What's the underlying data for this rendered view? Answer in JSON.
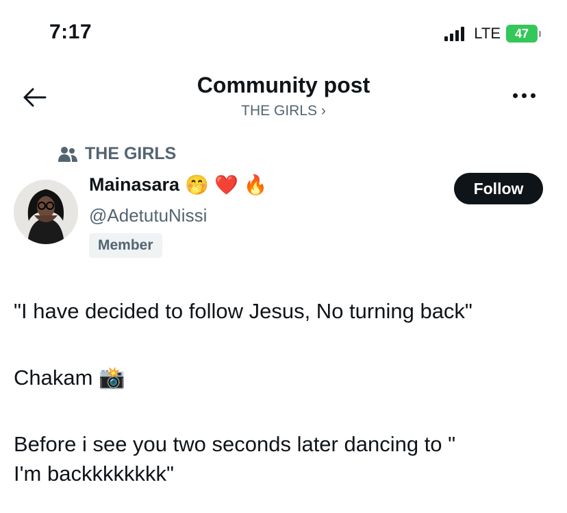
{
  "status_bar": {
    "time": "7:17",
    "network": "LTE",
    "battery": "47",
    "battery_color": "#34c759"
  },
  "header": {
    "title": "Community post",
    "subtitle": "THE GIRLS ›",
    "back_icon": "arrow-left-icon",
    "more_icon": "more-horizontal-icon"
  },
  "community": {
    "icon": "people-icon",
    "name": "THE GIRLS"
  },
  "author": {
    "name": "Mainasara",
    "emojis": [
      "🤭",
      "❤️",
      "🔥"
    ],
    "handle": "@AdetutuNissi",
    "badge": "Member"
  },
  "follow_button": {
    "label": "Follow"
  },
  "post": {
    "line1": "\"I have decided to follow Jesus, No turning back\"",
    "line2": "Chakam 📸",
    "line3": "Before i see you two seconds later dancing to \"",
    "line4": "I'm backkkkkkkk\""
  }
}
